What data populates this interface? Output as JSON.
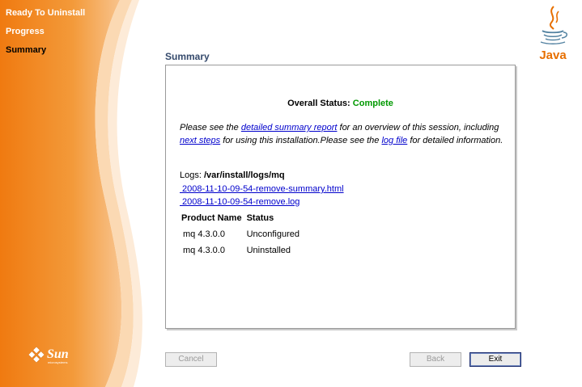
{
  "steps": [
    {
      "label": "Ready To Uninstall",
      "active": false
    },
    {
      "label": "Progress",
      "active": false
    },
    {
      "label": "Summary",
      "active": true
    }
  ],
  "branding": {
    "sun": "Sun",
    "sun_sub": "microsystems",
    "java": "Java"
  },
  "colors": {
    "accent_orange": "#F08A1C",
    "heading": "#354A6C",
    "complete": "#009900",
    "link": "#0000CC"
  },
  "main": {
    "heading": "Summary",
    "overall_label": "Overall Status:",
    "overall_value": "Complete",
    "para": {
      "t1": "Please see the ",
      "link1": "detailed summary report",
      "t2": " for an overview of this session, including ",
      "link2": "next steps",
      "t3": " for using this installation.Please see the ",
      "link3": "log file",
      "t4": " for detailed information."
    },
    "logs_label": "Logs:",
    "logs_path": "/var/install/logs/mq",
    "log_links": [
      " 2008-11-10-09-54-remove-summary.html",
      " 2008-11-10-09-54-remove.log"
    ],
    "table": {
      "headers": [
        "Product Name",
        "Status"
      ],
      "rows": [
        [
          "mq 4.3.0.0",
          "Unconfigured"
        ],
        [
          "mq 4.3.0.0",
          "Uninstalled"
        ]
      ]
    }
  },
  "buttons": {
    "cancel": "Cancel",
    "back": "Back",
    "exit": "Exit"
  }
}
